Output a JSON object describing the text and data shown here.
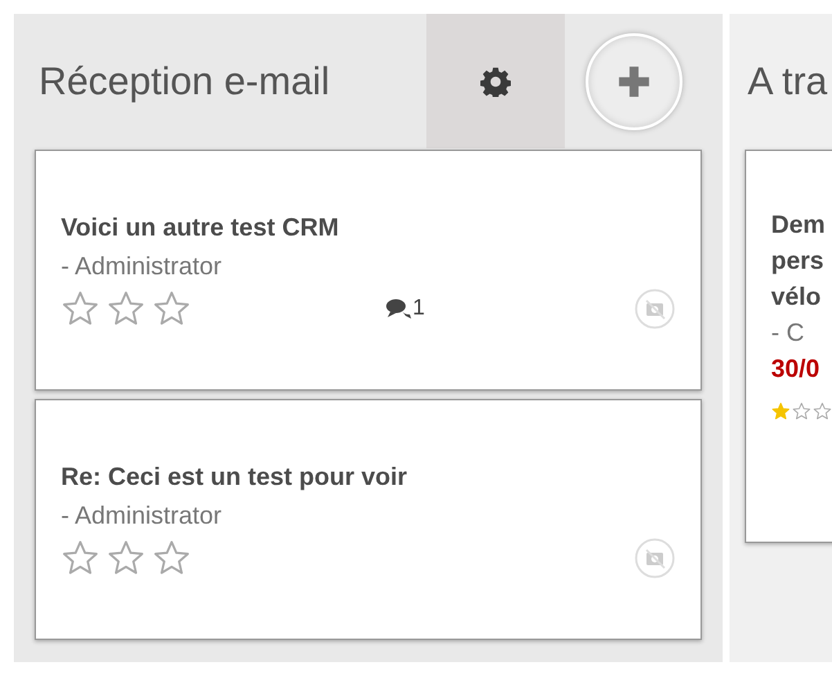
{
  "columns": [
    {
      "title": "Réception e-mail",
      "cards": [
        {
          "title_lines": [
            "Voici un autre test CRM"
          ],
          "author": "- Administrator",
          "stars": 0,
          "comments": "1"
        },
        {
          "title_lines": [
            "Re: Ceci est un test pour voir"
          ],
          "author": "- Administrator",
          "stars": 0
        }
      ]
    },
    {
      "title": "A tra",
      "cards": [
        {
          "title_lines": [
            "Dem",
            "pers",
            "vélo"
          ],
          "author": "- C",
          "date": "30/0",
          "stars": 1
        }
      ]
    }
  ]
}
